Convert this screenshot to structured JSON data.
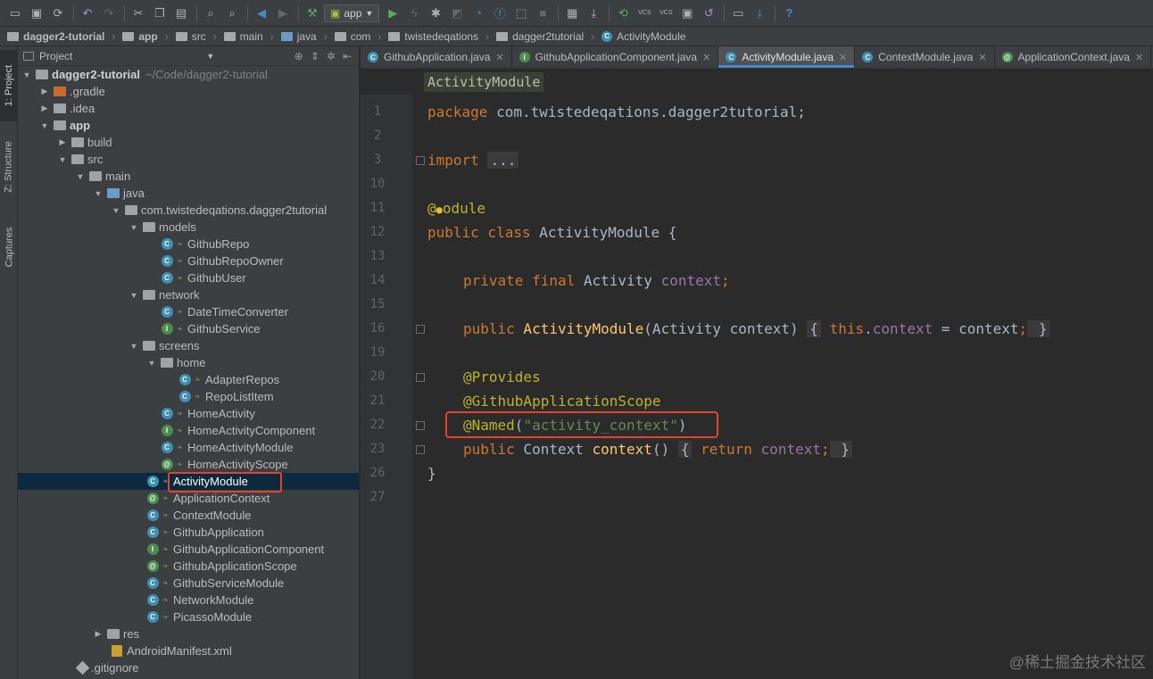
{
  "toolbar": {
    "run_config": "app",
    "vcs_label_1": "VCS",
    "vcs_label_2": "VCS"
  },
  "breadcrumb": [
    "dagger2-tutorial",
    "app",
    "src",
    "main",
    "java",
    "com",
    "twistedeqations",
    "dagger2tutorial",
    "ActivityModule"
  ],
  "tool_strip": {
    "project": "1: Project",
    "structure": "Z: Structure",
    "captures": "Captures"
  },
  "project_panel": {
    "title": "Project",
    "root_name": "dagger2-tutorial",
    "root_path": "~/Code/dagger2-tutorial",
    "tree": [
      {
        "label": "dagger2-tutorial"
      },
      {
        "label": ".gradle"
      },
      {
        "label": ".idea"
      },
      {
        "label": "app"
      },
      {
        "label": "build"
      },
      {
        "label": "src"
      },
      {
        "label": "main"
      },
      {
        "label": "java"
      },
      {
        "label": "com.twistedeqations.dagger2tutorial"
      },
      {
        "label": "models"
      },
      {
        "label": "GithubRepo"
      },
      {
        "label": "GithubRepoOwner"
      },
      {
        "label": "GithubUser"
      },
      {
        "label": "network"
      },
      {
        "label": "DateTimeConverter"
      },
      {
        "label": "GithubService"
      },
      {
        "label": "screens"
      },
      {
        "label": "home"
      },
      {
        "label": "AdapterRepos"
      },
      {
        "label": "RepoListItem"
      },
      {
        "label": "HomeActivity"
      },
      {
        "label": "HomeActivityComponent"
      },
      {
        "label": "HomeActivityModule"
      },
      {
        "label": "HomeActivityScope"
      },
      {
        "label": "ActivityModule"
      },
      {
        "label": "ApplicationContext"
      },
      {
        "label": "ContextModule"
      },
      {
        "label": "GithubApplication"
      },
      {
        "label": "GithubApplicationComponent"
      },
      {
        "label": "GithubApplicationScope"
      },
      {
        "label": "GithubServiceModule"
      },
      {
        "label": "NetworkModule"
      },
      {
        "label": "PicassoModule"
      },
      {
        "label": "res"
      },
      {
        "label": "AndroidManifest.xml"
      },
      {
        "label": ".gitignore"
      }
    ]
  },
  "editor": {
    "tabs": [
      {
        "label": "GithubApplication.java",
        "icon": "C"
      },
      {
        "label": "GithubApplicationComponent.java",
        "icon": "I"
      },
      {
        "label": "ActivityModule.java",
        "icon": "C",
        "active": true
      },
      {
        "label": "ContextModule.java",
        "icon": "C"
      },
      {
        "label": "ApplicationContext.java",
        "icon": "@"
      }
    ],
    "class_chip": "ActivityModule",
    "line_numbers": [
      "1",
      "2",
      "3",
      "10",
      "11",
      "12",
      "13",
      "14",
      "15",
      "16",
      "19",
      "20",
      "21",
      "22",
      "23",
      "26",
      "27"
    ],
    "code": {
      "l1_kw": "package",
      "l1_rest": " com.twistedeqations.dagger2tutorial;",
      "l3_kw": "import",
      "l3_fold": "...",
      "l11_at": "@",
      "l11_rest": "odule",
      "l12_kw": "public class",
      "l12_name": " ActivityModule",
      "l12_brace": " {",
      "l14_kw": "private final",
      "l14_type": " Activity ",
      "l14_field": "context",
      "l14_semi": ";",
      "l16_kw": "public",
      "l16_ctor": " ActivityModule",
      "l16_params": "(Activity context) ",
      "l16_open": "{",
      "l16_this": " this",
      "l16_dot": ".",
      "l16_field": "context",
      "l16_assign": " = context",
      "l16_semi": ";",
      "l16_close": " }",
      "l20_ann": "@Provides",
      "l21_ann": "@GithubApplicationScope",
      "l22_ann": "@Named",
      "l22_open": "(",
      "l22_str": "\"activity_context\"",
      "l22_close": ")",
      "l23_kw": "public",
      "l23_type": " Context ",
      "l23_method": "context",
      "l23_parens": "() ",
      "l23_open": "{",
      "l23_ret": " return ",
      "l23_field": "context",
      "l23_semi": ";",
      "l23_close": " }",
      "l26": "}"
    }
  },
  "watermark": "@稀土掘金技术社区"
}
